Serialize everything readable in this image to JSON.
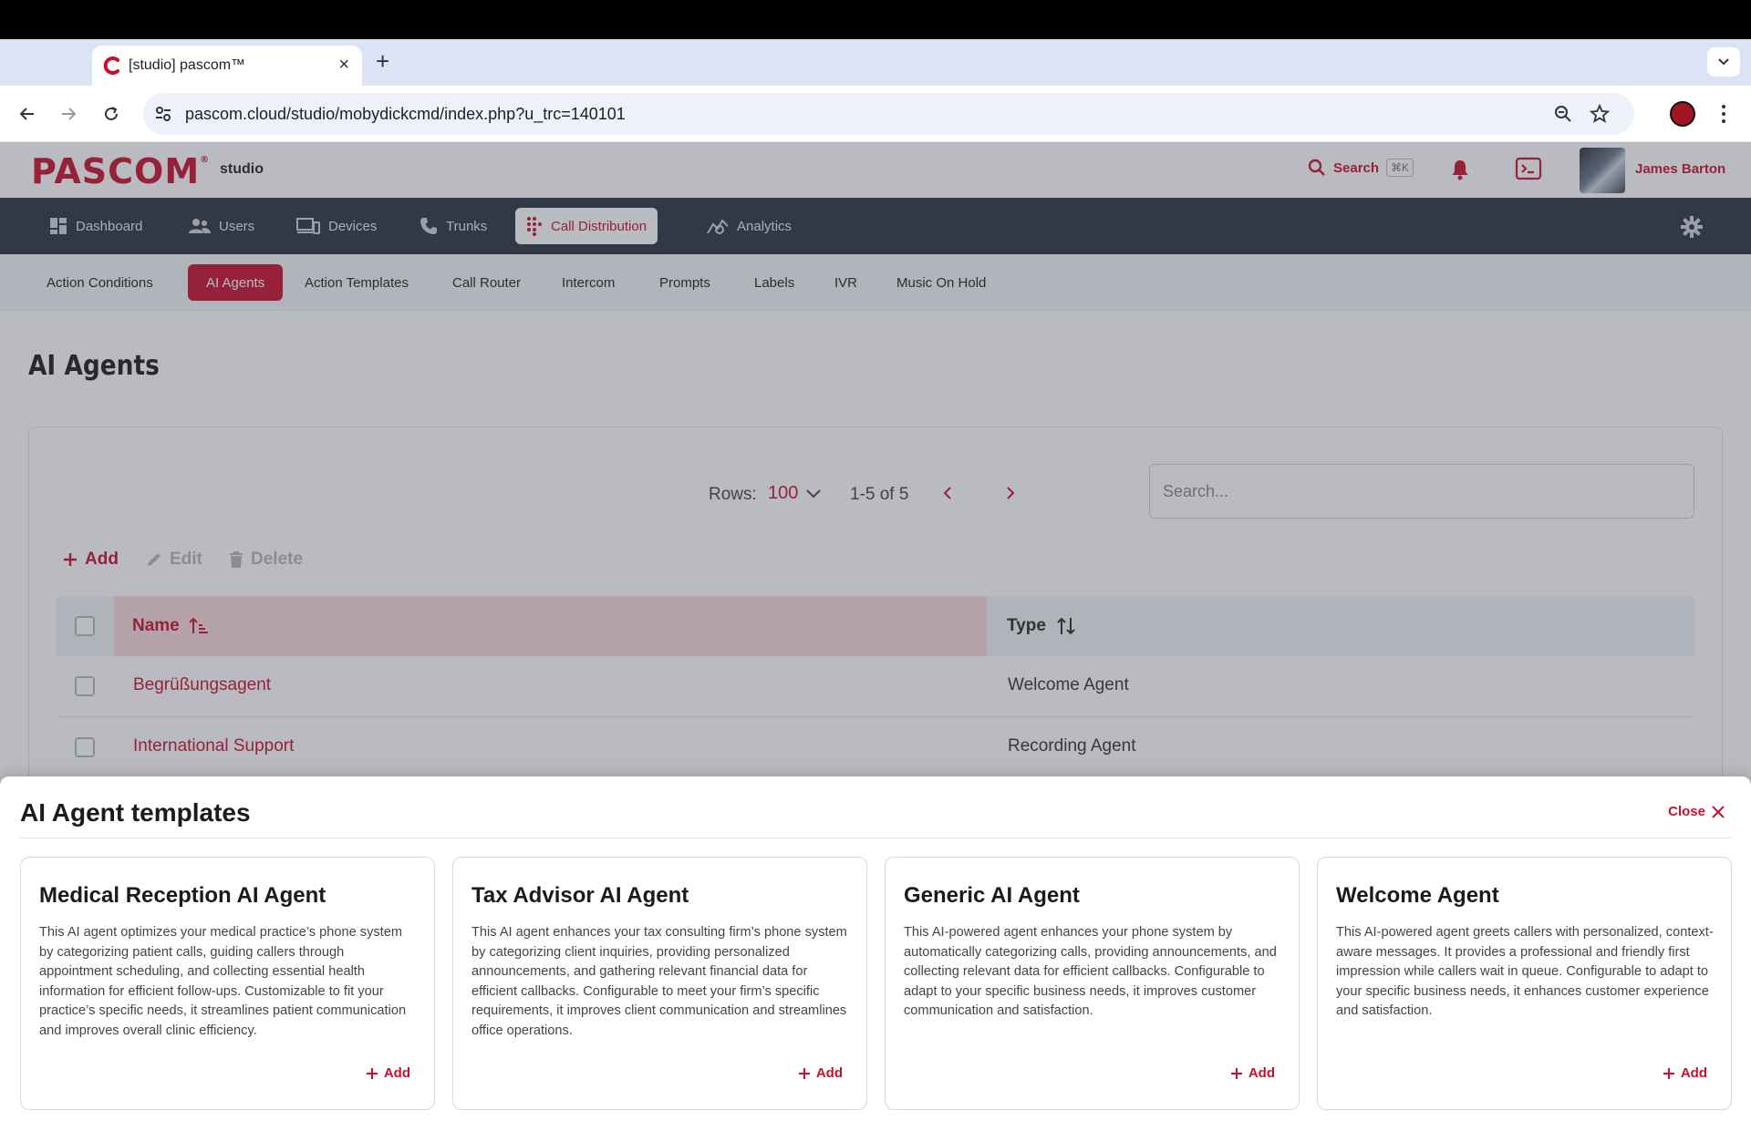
{
  "browser": {
    "tab_title": "[studio] pascom™",
    "url": "pascom.cloud/studio/mobydickcmd/index.php?u_trc=140101"
  },
  "header": {
    "logo": "PASCOM",
    "logo_mark": "®",
    "product": "studio",
    "search_label": "Search",
    "search_shortcut": "⌘K",
    "user_name": "James Barton"
  },
  "main_nav": {
    "items": [
      {
        "label": "Dashboard",
        "icon": "dashboard-icon"
      },
      {
        "label": "Users",
        "icon": "users-icon"
      },
      {
        "label": "Devices",
        "icon": "devices-icon"
      },
      {
        "label": "Trunks",
        "icon": "phone-icon"
      },
      {
        "label": "Call Distribution",
        "icon": "grid-dots-icon",
        "active": true
      },
      {
        "label": "Analytics",
        "icon": "analytics-icon"
      }
    ]
  },
  "sub_nav": {
    "items": [
      {
        "label": "Action Conditions"
      },
      {
        "label": "AI Agents",
        "active": true
      },
      {
        "label": "Action Templates"
      },
      {
        "label": "Call Router"
      },
      {
        "label": "Intercom"
      },
      {
        "label": "Prompts"
      },
      {
        "label": "Labels"
      },
      {
        "label": "IVR"
      },
      {
        "label": "Music On Hold"
      }
    ]
  },
  "page": {
    "title": "AI Agents",
    "rows_label": "Rows:",
    "rows_value": "100",
    "range": "1-5 of 5",
    "search_placeholder": "Search...",
    "actions": {
      "add": "Add",
      "edit": "Edit",
      "delete": "Delete"
    },
    "columns": {
      "name": "Name",
      "type": "Type"
    },
    "rows": [
      {
        "name": "Begrüßungsagent",
        "type": "Welcome Agent"
      },
      {
        "name": "International Support",
        "type": "Recording Agent"
      }
    ]
  },
  "sheet": {
    "title": "AI Agent templates",
    "close_label": "Close",
    "templates": [
      {
        "title": "Medical Reception AI Agent",
        "description": "This AI agent optimizes your medical practice’s phone system by categorizing patient calls, guiding callers through appointment scheduling, and collecting essential health information for efficient follow-ups. Customizable to fit your practice’s specific needs, it streamlines patient communication and improves overall clinic efficiency.",
        "add_label": "Add"
      },
      {
        "title": "Tax Advisor AI Agent",
        "description": "This AI agent enhances your tax consulting firm’s phone system by categorizing client inquiries, providing personalized announcements, and gathering relevant financial data for efficient callbacks. Configurable to meet your firm’s specific requirements, it improves client communication and streamlines office operations.",
        "add_label": "Add"
      },
      {
        "title": "Generic AI Agent",
        "description": "This AI-powered agent enhances your phone system by automatically categorizing calls, providing announcements, and collecting relevant data for efficient callbacks. Configurable to adapt to your specific business needs, it improves customer communication and satisfaction.",
        "add_label": "Add"
      },
      {
        "title": "Welcome Agent",
        "description": "This AI-powered agent greets callers with personalized, context-aware messages. It provides a professional and friendly first impression while callers wait in queue. Configurable to adapt to your specific business needs, it enhances customer experience and satisfaction.",
        "add_label": "Add"
      }
    ]
  },
  "colors": {
    "brand": "#c8102e",
    "nav_bg": "#2d3440",
    "overlay": "rgba(60,66,80,0.36)"
  }
}
